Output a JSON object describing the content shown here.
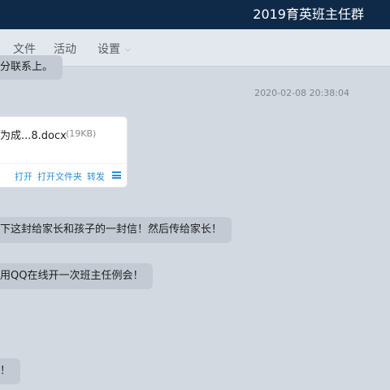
{
  "window": {
    "title": "2019育英班主任群"
  },
  "tabs": [
    {
      "label": "文件"
    },
    {
      "label": "活动"
    },
    {
      "label": "设置"
    }
  ],
  "icons": {
    "settings_dropdown": "chevron-down-icon",
    "file_menu": "hamburger-menu-icon"
  },
  "messages": [
    {
      "text": "分联系上。"
    },
    {
      "timestamp": "2020-02-08 20:38:04"
    },
    {
      "file": {
        "name": "为成...8.docx",
        "size": "(19KB)",
        "actions": {
          "open": "打开",
          "open_folder": "打开文件夹",
          "forward": "转发"
        }
      }
    },
    {
      "text": "下这封给家长和孩子的一封信！然后传给家长！"
    },
    {
      "text": "用QQ在线开一次班主任例会！"
    },
    {
      "text": "！"
    }
  ],
  "colors": {
    "titlebar": "#0f2a49",
    "background": "#d3d9e1",
    "bubble": "#c3cad3",
    "link": "#2a8fd8"
  }
}
